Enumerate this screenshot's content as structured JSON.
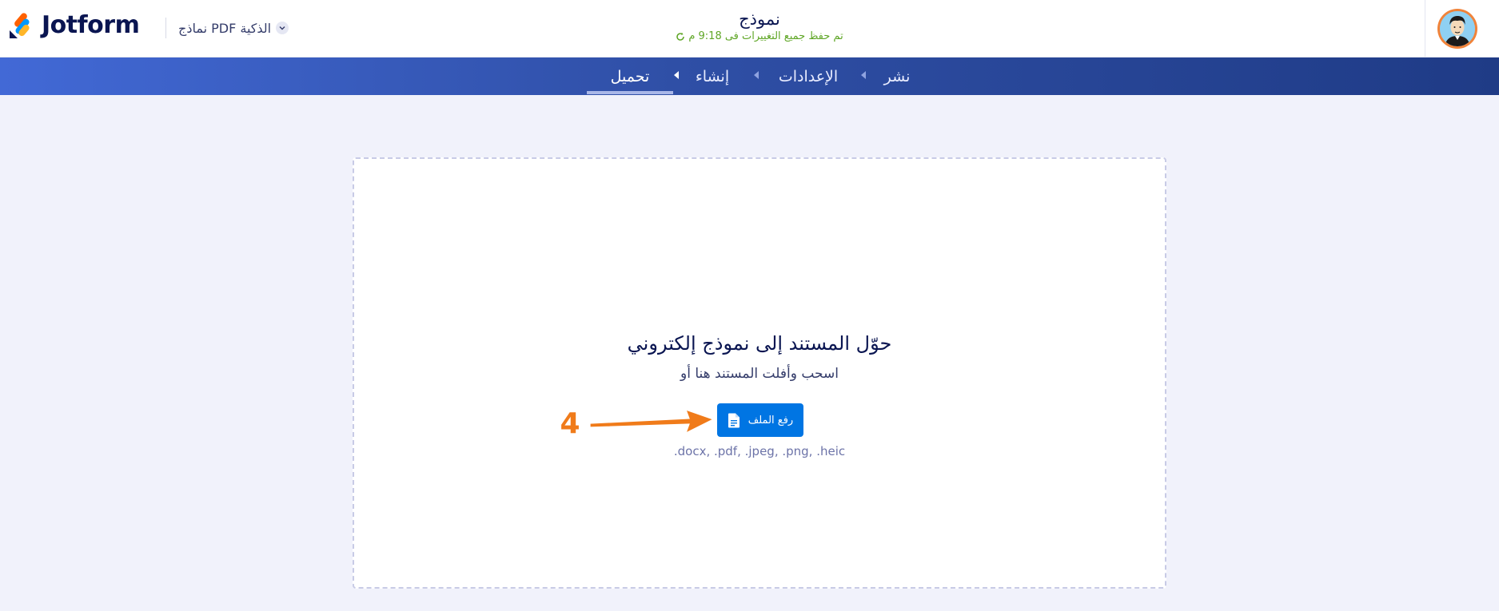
{
  "brand": {
    "name": "Jotform"
  },
  "product_switcher": {
    "label": "الذكية PDF نماذج"
  },
  "form": {
    "title": "نموذج",
    "save_status": "تم حفظ جميع التغييرات فى 9:18 م"
  },
  "nav": {
    "items": [
      {
        "label": "تحميل",
        "active": true
      },
      {
        "label": "إنشاء",
        "active": false
      },
      {
        "label": "الإعدادات",
        "active": false
      },
      {
        "label": "نشر",
        "active": false
      }
    ]
  },
  "dropzone": {
    "title": "حوّل المستند إلى نموذج إلكتروني",
    "subtitle": "اسحب وأفلت المستند هنا أو",
    "upload_button_label": "رفع الملف",
    "formats": ".docx, .pdf, .jpeg, .png, .heic"
  },
  "annotation": {
    "step_number": "4"
  },
  "colors": {
    "accent": "#0075e3",
    "brand_navy": "#0a1551",
    "save_green": "#5fa626",
    "annotation_orange": "#f07b1a"
  },
  "icons": {
    "logo": "jotform-logo-icon",
    "chevron": "chevron-down-icon",
    "refresh": "refresh-icon",
    "file": "document-icon",
    "avatar": "user-avatar"
  }
}
